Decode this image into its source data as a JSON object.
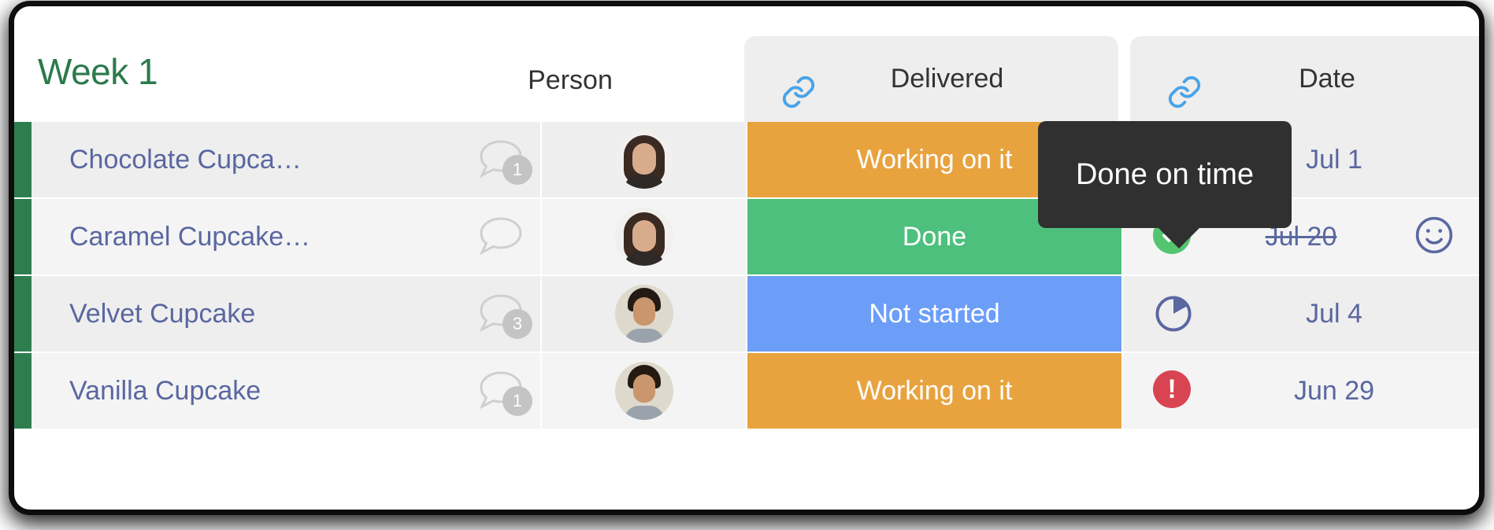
{
  "board": {
    "title": "Week 1",
    "accent_green": "#2c7a4b",
    "group_bar_color": "#2f7d4f",
    "columns": {
      "person_label": "Person",
      "delivered_label": "Delivered",
      "date_label": "Date",
      "link_icon": "link-icon"
    }
  },
  "tooltip": {
    "text": "Done on time",
    "background": "#303030"
  },
  "status_colors": {
    "working_on_it": "#e8a33f",
    "done": "#4ec07d",
    "not_started": "#6c9ef8"
  },
  "rows": [
    {
      "name": "Chocolate Cupca…",
      "comment_count": "1",
      "has_comment_badge": true,
      "person_avatar": "avatar-female",
      "status": "Working on it",
      "status_color": "#e8a33f",
      "date": "Jul 1",
      "date_struck": false,
      "date_icon": "",
      "has_date_icon": false,
      "has_smiley": false
    },
    {
      "name": "Caramel Cupcake…",
      "comment_count": "",
      "has_comment_badge": false,
      "person_avatar": "avatar-female",
      "status": "Done",
      "status_color": "#4ec07d",
      "date": "Jul 20",
      "date_struck": true,
      "date_icon": "check-circle-icon",
      "has_date_icon": true,
      "has_smiley": true
    },
    {
      "name": "Velvet Cupcake",
      "comment_count": "3",
      "has_comment_badge": true,
      "person_avatar": "avatar-male",
      "status": "Not started",
      "status_color": "#6c9ef8",
      "date": "Jul 4",
      "date_struck": false,
      "date_icon": "pie-progress-icon",
      "has_date_icon": true,
      "has_smiley": false
    },
    {
      "name": "Vanilla Cupcake",
      "comment_count": "1",
      "has_comment_badge": true,
      "person_avatar": "avatar-male",
      "status": "Working on it",
      "status_color": "#e8a33f",
      "date": "Jun 29",
      "date_struck": false,
      "date_icon": "alert-circle-icon",
      "has_date_icon": true,
      "has_smiley": false
    }
  ]
}
